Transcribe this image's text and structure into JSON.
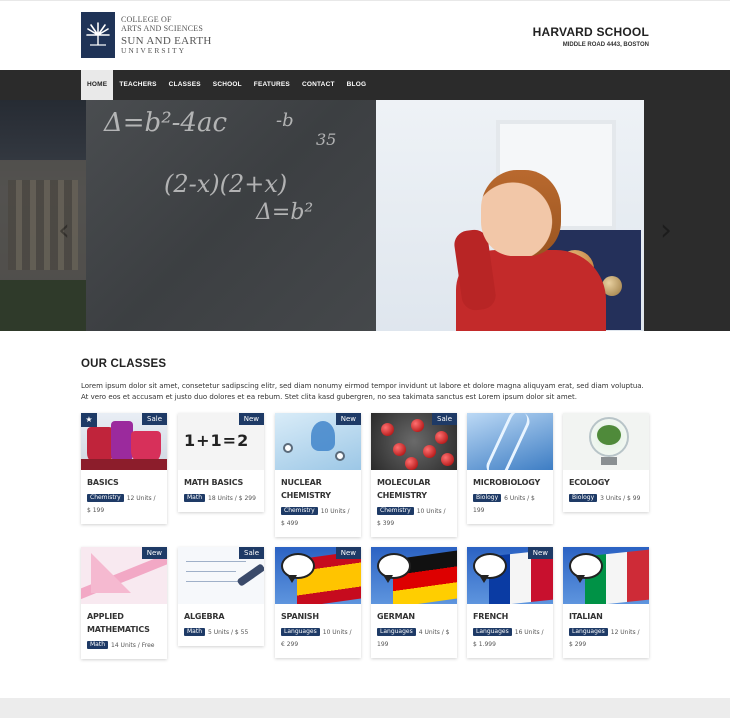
{
  "header": {
    "logo_line1a": "COLLEGE OF",
    "logo_line1b": "ARTS AND SCIENCES",
    "logo_line2": "SUN AND EARTH",
    "logo_line3": "UNIVERSITY",
    "school_name": "HARVARD SCHOOL",
    "school_address": "MIDDLE ROAD 4443, BOSTON"
  },
  "nav": {
    "items": [
      {
        "label": "HOME",
        "active": true
      },
      {
        "label": "TEACHERS"
      },
      {
        "label": "CLASSES"
      },
      {
        "label": "SCHOOL"
      },
      {
        "label": "FEATURES"
      },
      {
        "label": "CONTACT"
      },
      {
        "label": "BLOG"
      }
    ]
  },
  "hero": {
    "arrow_left": "‹",
    "arrow_right": "›"
  },
  "classes": {
    "title": "OUR CLASSES",
    "description": "Lorem ipsum dolor sit amet, consetetur sadipscing elitr, sed diam nonumy eirmod tempor invidunt ut labore et dolore magna aliquyam erat, sed diam voluptua. At vero eos et accusam et justo duo dolores et ea rebum. Stet clita kasd gubergren, no sea takimata sanctus est Lorem ipsum dolor sit amet.",
    "cards": [
      {
        "title": "BASICS",
        "category": "Chemistry",
        "info": "12 Units / $ 199",
        "badge": "Sale",
        "star": "★",
        "image": "test-tubes"
      },
      {
        "title": "MATH BASICS",
        "category": "Math",
        "info": "18 Units / $ 299",
        "badge": "New",
        "image": "math-blocks"
      },
      {
        "title": "NUCLEAR CHEMISTRY",
        "category": "Chemistry",
        "info": "10 Units / $ 499",
        "badge": "New",
        "image": "lab-molecules"
      },
      {
        "title": "MOLECULAR CHEMISTRY",
        "category": "Chemistry",
        "info": "10 Units / $ 399",
        "badge": "Sale",
        "image": "red-molecules"
      },
      {
        "title": "MICROBIOLOGY",
        "category": "Biology",
        "info": "6 Units / $ 199",
        "image": "dna-helix"
      },
      {
        "title": "ECOLOGY",
        "category": "Biology",
        "info": "3 Units / $ 99",
        "image": "bulb-tree"
      },
      {
        "title": "APPLIED MATHEMATICS",
        "category": "Math",
        "info": "14 Units / Free",
        "badge": "New",
        "image": "rulers"
      },
      {
        "title": "ALGEBRA",
        "category": "Math",
        "info": "5 Units / $ 55",
        "badge": "Sale",
        "image": "formula-paper"
      },
      {
        "title": "SPANISH",
        "category": "Languages",
        "info": "10 Units / € 299",
        "badge": "New",
        "image": "flag-spain"
      },
      {
        "title": "GERMAN",
        "category": "Languages",
        "info": "4 Units / $ 199",
        "image": "flag-germany"
      },
      {
        "title": "FRENCH",
        "category": "Languages",
        "info": "16 Units / $ 1.999",
        "badge": "New",
        "image": "flag-france"
      },
      {
        "title": "ITALIAN",
        "category": "Languages",
        "info": "12 Units / $ 299",
        "image": "flag-italy"
      }
    ]
  },
  "colors": {
    "nav_bg": "#2b2b2b",
    "accent": "#1e3a66"
  }
}
